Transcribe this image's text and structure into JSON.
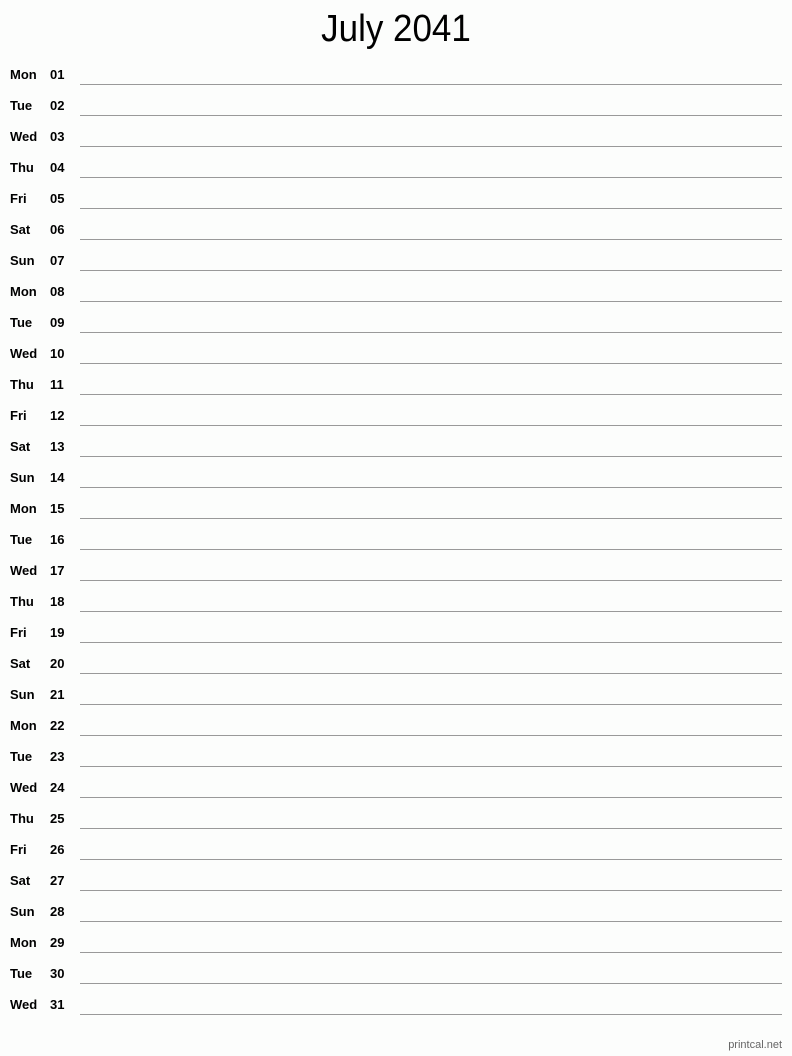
{
  "title": "July 2041",
  "days": [
    {
      "dow": "Mon",
      "day": "01"
    },
    {
      "dow": "Tue",
      "day": "02"
    },
    {
      "dow": "Wed",
      "day": "03"
    },
    {
      "dow": "Thu",
      "day": "04"
    },
    {
      "dow": "Fri",
      "day": "05"
    },
    {
      "dow": "Sat",
      "day": "06"
    },
    {
      "dow": "Sun",
      "day": "07"
    },
    {
      "dow": "Mon",
      "day": "08"
    },
    {
      "dow": "Tue",
      "day": "09"
    },
    {
      "dow": "Wed",
      "day": "10"
    },
    {
      "dow": "Thu",
      "day": "11"
    },
    {
      "dow": "Fri",
      "day": "12"
    },
    {
      "dow": "Sat",
      "day": "13"
    },
    {
      "dow": "Sun",
      "day": "14"
    },
    {
      "dow": "Mon",
      "day": "15"
    },
    {
      "dow": "Tue",
      "day": "16"
    },
    {
      "dow": "Wed",
      "day": "17"
    },
    {
      "dow": "Thu",
      "day": "18"
    },
    {
      "dow": "Fri",
      "day": "19"
    },
    {
      "dow": "Sat",
      "day": "20"
    },
    {
      "dow": "Sun",
      "day": "21"
    },
    {
      "dow": "Mon",
      "day": "22"
    },
    {
      "dow": "Tue",
      "day": "23"
    },
    {
      "dow": "Wed",
      "day": "24"
    },
    {
      "dow": "Thu",
      "day": "25"
    },
    {
      "dow": "Fri",
      "day": "26"
    },
    {
      "dow": "Sat",
      "day": "27"
    },
    {
      "dow": "Sun",
      "day": "28"
    },
    {
      "dow": "Mon",
      "day": "29"
    },
    {
      "dow": "Tue",
      "day": "30"
    },
    {
      "dow": "Wed",
      "day": "31"
    }
  ],
  "footer": "printcal.net"
}
